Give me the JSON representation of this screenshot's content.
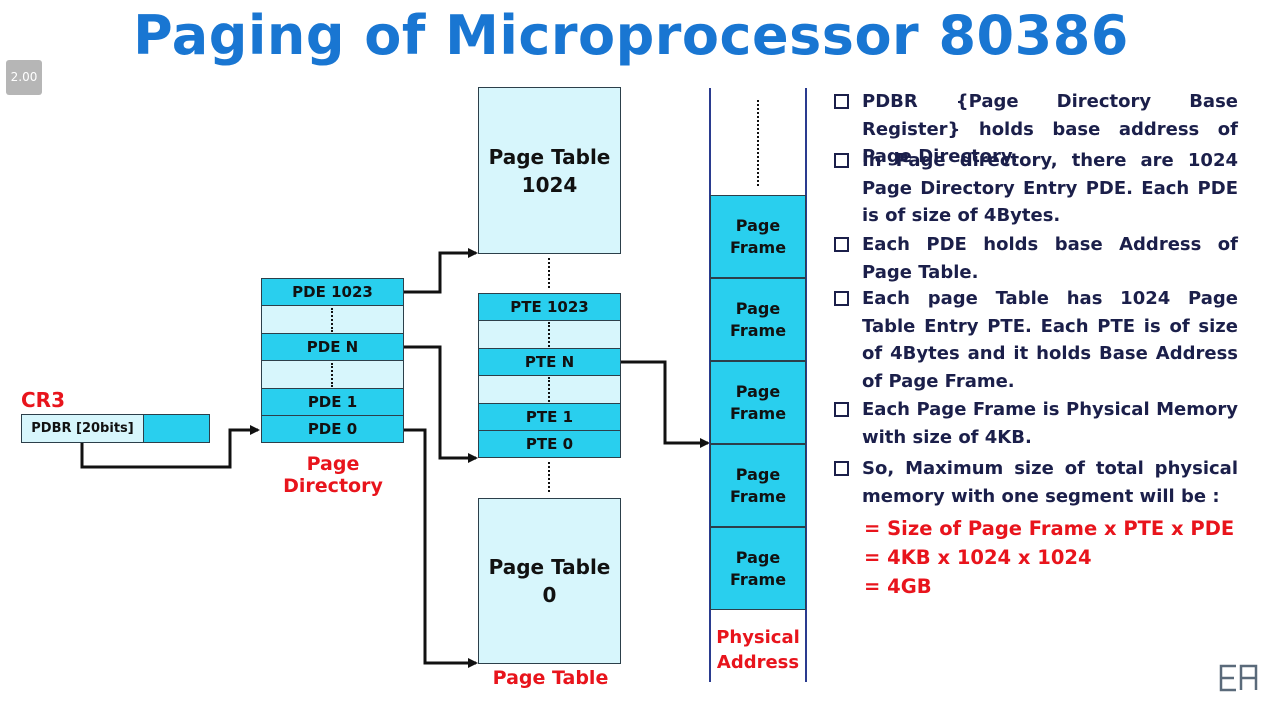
{
  "title": "Paging of Microprocessor 80386",
  "playback_speed": "2.00",
  "cr3": {
    "label": "CR3",
    "register": "PDBR [20bits]"
  },
  "page_directory": {
    "entries": [
      "PDE 1023",
      "PDE N",
      "PDE 1",
      "PDE 0"
    ],
    "caption": "Page Directory"
  },
  "page_tables": {
    "top_box": {
      "line1": "Page Table",
      "line2": "1024"
    },
    "bottom_box": {
      "line1": "Page Table",
      "line2": "0"
    },
    "entries": [
      "PTE 1023",
      "PTE N",
      "PTE 1",
      "PTE 0"
    ],
    "caption": "Page Table"
  },
  "physical_memory": {
    "frames": [
      {
        "line1": "Page",
        "line2": "Frame"
      },
      {
        "line1": "Page",
        "line2": "Frame"
      },
      {
        "line1": "Page",
        "line2": "Frame"
      },
      {
        "line1": "Page",
        "line2": "Frame"
      },
      {
        "line1": "Page",
        "line2": "Frame"
      }
    ],
    "caption_line1": "Physical",
    "caption_line2": "Address"
  },
  "bullets": [
    "PDBR {Page Directory Base Register} holds base address of Page Directory.",
    "In Page directory, there are 1024 Page Directory Entry PDE. Each PDE is of size of 4Bytes.",
    "Each PDE holds base Address of Page Table.",
    "Each page Table has 1024 Page Table Entry PTE. Each PTE is of size of 4Bytes and it holds Base Address of Page Frame.",
    "Each Page Frame is Physical Memory with size of 4KB.",
    "So, Maximum size of total physical memory with one segment will be :"
  ],
  "formula": [
    "= Size of Page Frame x PTE x PDE",
    "= 4KB x 1024 x 1024",
    "= 4GB"
  ],
  "colors": {
    "title": "#1976d2",
    "accent_red": "#e8141c",
    "cell_cyan": "#29cfee",
    "cell_pale": "#d7f6fc",
    "text_navy": "#1b1f4a"
  }
}
